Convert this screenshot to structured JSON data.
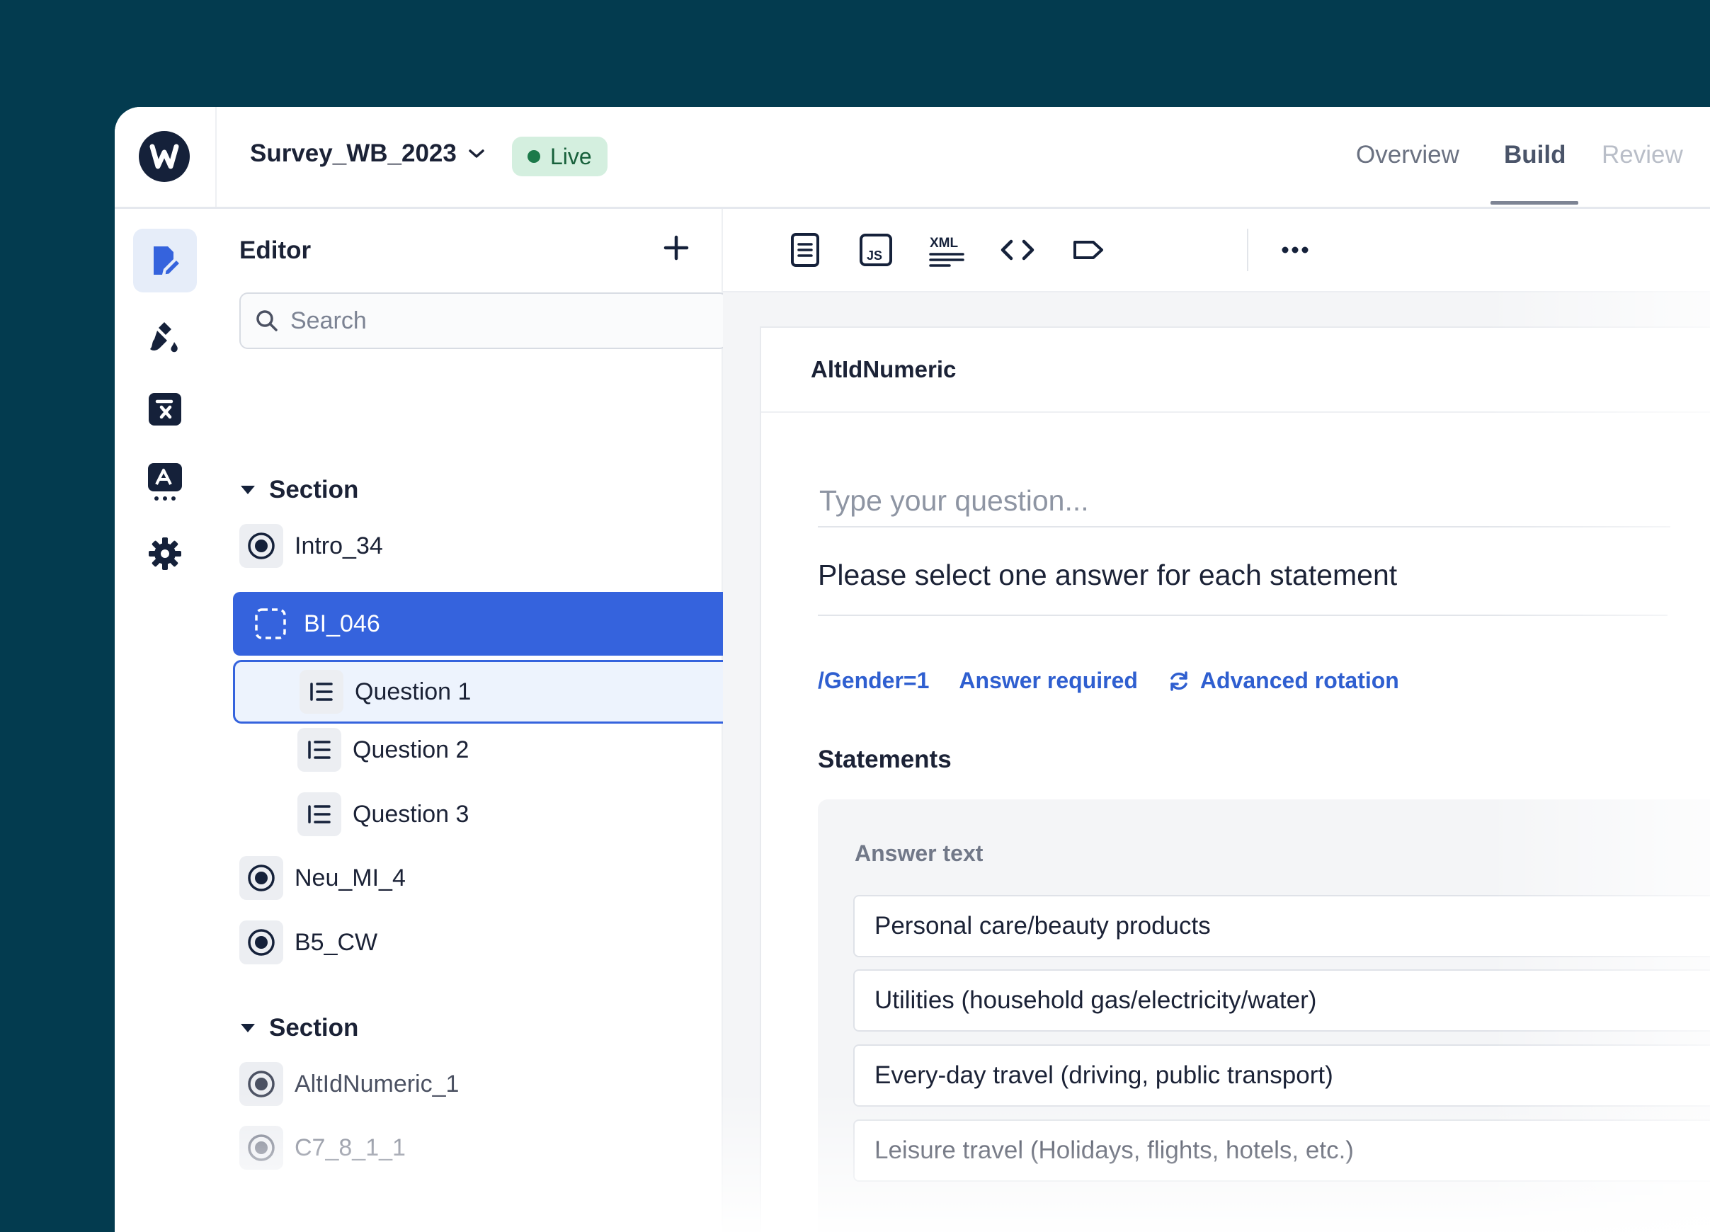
{
  "header": {
    "survey_name": "Survey_WB_2023",
    "status_badge": "Live",
    "tabs": [
      {
        "label": "Overview"
      },
      {
        "label": "Build"
      },
      {
        "label": "Review"
      }
    ],
    "active_tab": "Build"
  },
  "rail": {
    "items": [
      {
        "icon": "edit-icon",
        "active": true
      },
      {
        "icon": "paint-brush-icon",
        "active": false
      },
      {
        "icon": "formula-icon",
        "active": false
      },
      {
        "icon": "translate-icon",
        "active": false
      },
      {
        "icon": "gear-icon",
        "active": false
      }
    ]
  },
  "editor": {
    "title": "Editor",
    "search_placeholder": "Search",
    "sections": [
      {
        "label": "Section",
        "items": [
          {
            "label": "Intro_34",
            "type": "block"
          },
          {
            "label": "BI_046",
            "type": "block",
            "selected": true,
            "children": [
              {
                "label": "Question 1",
                "selected": true
              },
              {
                "label": "Question 2"
              },
              {
                "label": "Question 3"
              }
            ]
          },
          {
            "label": "Neu_MI_4",
            "type": "block"
          },
          {
            "label": "B5_CW",
            "type": "block"
          }
        ]
      },
      {
        "label": "Section",
        "items": [
          {
            "label": "AltIdNumeric_1",
            "type": "block"
          },
          {
            "label": "C7_8_1_1",
            "type": "block"
          }
        ]
      }
    ]
  },
  "toolbar": {
    "buttons": [
      "document-icon",
      "javascript-icon",
      "xml-icon",
      "code-icon",
      "tag-icon",
      "more-icon"
    ]
  },
  "question": {
    "card_title": "AltIdNumeric",
    "question_placeholder": "Type your question...",
    "instruction": "Please select one answer for each statement",
    "links": {
      "condition": "/Gender=1",
      "required": "Answer required",
      "rotation": "Advanced rotation"
    },
    "statements_title": "Statements",
    "answer_text_label": "Answer text",
    "answers": [
      "Personal care/beauty products",
      "Utilities (household gas/electricity/water)",
      "Every-day travel (driving, public transport)",
      "Leisure travel (Holidays, flights, hotels, etc.)"
    ]
  },
  "colors": {
    "background": "#033b4f",
    "accent": "#3563dd",
    "live_badge_bg": "#d4efdf",
    "live_badge_text": "#17603b",
    "link": "#2f5fd0"
  }
}
